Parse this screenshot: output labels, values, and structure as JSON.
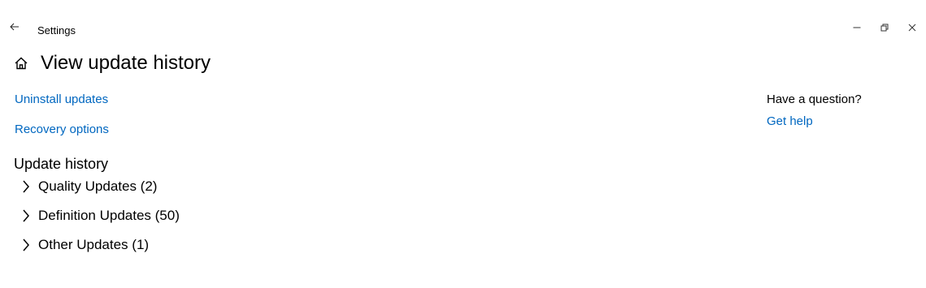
{
  "window": {
    "title": "Settings",
    "controls": {
      "back_icon": "arrow-left-icon",
      "minimize_icon": "minimize-icon",
      "maximize_icon": "restore-icon",
      "close_icon": "close-icon"
    }
  },
  "header": {
    "home_icon": "home-icon",
    "title": "View update history"
  },
  "links": {
    "uninstall": "Uninstall updates",
    "recovery": "Recovery options"
  },
  "history": {
    "heading": "Update history",
    "groups": [
      {
        "label": "Quality Updates (2)",
        "expanded": false
      },
      {
        "label": "Definition Updates (50)",
        "expanded": false
      },
      {
        "label": "Other Updates (1)",
        "expanded": false
      }
    ]
  },
  "help": {
    "question": "Have a question?",
    "link": "Get help"
  },
  "colors": {
    "link": "#0067c0",
    "text": "#000000",
    "background": "#ffffff"
  }
}
